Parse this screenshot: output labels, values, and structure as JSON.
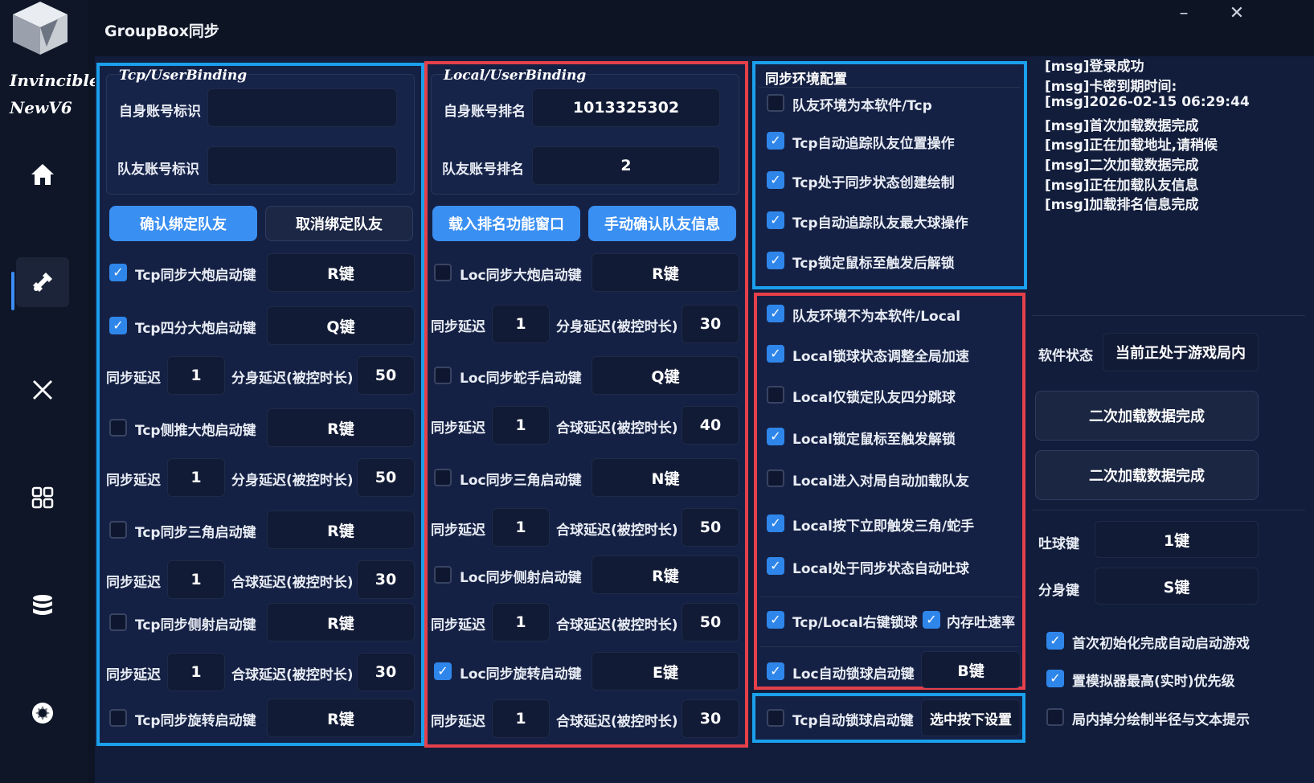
{
  "app": {
    "title": "GroupBox同步",
    "brand_line1": "Invincible",
    "brand_line2": "NewV6"
  },
  "tcp": {
    "legend": "Tcp/UserBinding",
    "self_label": "自身账号标识",
    "self_value": "",
    "mate_label": "队友账号标识",
    "mate_value": "",
    "confirm_button": "确认绑定队友",
    "cancel_button": "取消绑定队友",
    "rows": [
      {
        "type": "check",
        "checked": true,
        "label": "Tcp同步大炮启动键",
        "key": "R键"
      },
      {
        "type": "check",
        "checked": true,
        "label": "Tcp四分大炮启动键",
        "key": "Q键"
      },
      {
        "type": "delay",
        "label": "同步延迟",
        "value": "1",
        "label2": "分身延迟(被控时长)",
        "value2": "50"
      },
      {
        "type": "check",
        "checked": false,
        "label": "Tcp侧推大炮启动键",
        "key": "R键"
      },
      {
        "type": "delay",
        "label": "同步延迟",
        "value": "1",
        "label2": "分身延迟(被控时长)",
        "value2": "50"
      },
      {
        "type": "check",
        "checked": false,
        "label": "Tcp同步三角启动键",
        "key": "R键"
      },
      {
        "type": "delay",
        "label": "同步延迟",
        "value": "1",
        "label2": "合球延迟(被控时长)",
        "value2": "30"
      },
      {
        "type": "check",
        "checked": false,
        "label": "Tcp同步侧射启动键",
        "key": "R键"
      },
      {
        "type": "delay",
        "label": "同步延迟",
        "value": "1",
        "label2": "合球延迟(被控时长)",
        "value2": "30"
      },
      {
        "type": "check",
        "checked": false,
        "label": "Tcp同步旋转启动键",
        "key": "R键"
      }
    ]
  },
  "local": {
    "legend": "Local/UserBinding",
    "self_label": "自身账号排名",
    "self_value": "1013325302",
    "mate_label": "队友账号排名",
    "mate_value": "2",
    "load_button": "载入排名功能窗口",
    "manual_button": "手动确认队友信息",
    "rows": [
      {
        "type": "check",
        "checked": false,
        "label": "Loc同步大炮启动键",
        "key": "R键"
      },
      {
        "type": "delay",
        "label": "同步延迟",
        "value": "1",
        "label2": "分身延迟(被控时长)",
        "value2": "30"
      },
      {
        "type": "check",
        "checked": false,
        "label": "Loc同步蛇手启动键",
        "key": "Q键"
      },
      {
        "type": "delay",
        "label": "同步延迟",
        "value": "1",
        "label2": "合球延迟(被控时长)",
        "value2": "40"
      },
      {
        "type": "check",
        "checked": false,
        "label": "Loc同步三角启动键",
        "key": "N键"
      },
      {
        "type": "delay",
        "label": "同步延迟",
        "value": "1",
        "label2": "合球延迟(被控时长)",
        "value2": "50"
      },
      {
        "type": "check",
        "checked": false,
        "label": "Loc同步侧射启动键",
        "key": "R键"
      },
      {
        "type": "delay",
        "label": "同步延迟",
        "value": "1",
        "label2": "合球延迟(被控时长)",
        "value2": "50"
      },
      {
        "type": "check",
        "checked": true,
        "label": "Loc同步旋转启动键",
        "key": "E键"
      },
      {
        "type": "delay",
        "label": "同步延迟",
        "value": "1",
        "label2": "合球延迟(被控时长)",
        "value2": "30"
      }
    ]
  },
  "sync_env": {
    "legend": "同步环境配置",
    "items": [
      {
        "checked": false,
        "label": "队友环境为本软件/Tcp"
      },
      {
        "checked": true,
        "label": "Tcp自动追踪队友位置操作"
      },
      {
        "checked": true,
        "label": "Tcp处于同步状态创建绘制"
      },
      {
        "checked": true,
        "label": "Tcp自动追踪队友最大球操作"
      },
      {
        "checked": true,
        "label": "Tcp锁定鼠标至触发后解锁"
      }
    ]
  },
  "local_env": {
    "items": [
      {
        "checked": true,
        "label": "队友环境不为本软件/Local"
      },
      {
        "checked": true,
        "label": "Local锁球状态调整全局加速"
      },
      {
        "checked": false,
        "label": "Local仅锁定队友四分跳球"
      },
      {
        "checked": true,
        "label": "Local锁定鼠标至触发解锁"
      },
      {
        "checked": false,
        "label": "Local进入对局自动加载队友"
      },
      {
        "checked": true,
        "label": "Local按下立即触发三角/蛇手"
      },
      {
        "checked": true,
        "label": "Local处于同步状态自动吐球"
      }
    ],
    "right_key_label": "Tcp/Local右键锁球",
    "right_key_checked": true,
    "mem_label": "内存吐速率",
    "mem_checked": true,
    "auto_lock_label": "Loc自动锁球启动键",
    "auto_lock_checked": true,
    "auto_lock_key": "B键"
  },
  "tcp_auto_lock": {
    "checked": false,
    "label": "Tcp自动锁球启动键",
    "key": "选中按下设置"
  },
  "log": {
    "lines": [
      "[msg]登录成功",
      "[msg]卡密到期时间:",
      "[msg]2026-02-15 06:29:44",
      "[msg]首次加载数据完成",
      "[msg]正在加载地址,请稍候",
      "[msg]二次加载数据完成",
      "[msg]正在加载队友信息",
      "[msg]加载排名信息完成"
    ]
  },
  "status": {
    "label": "软件状态",
    "value": "当前正处于游戏局内",
    "button1": "二次加载数据完成",
    "button2": "二次加载数据完成",
    "spit_label": "吐球键",
    "spit_key": "1键",
    "split_label": "分身键",
    "split_key": "S键",
    "options": [
      {
        "checked": true,
        "label": "首次初始化完成自动启动游戏"
      },
      {
        "checked": true,
        "label": "置模拟器最高(实时)优先级"
      },
      {
        "checked": false,
        "label": "局内掉分绘制半径与文本提示"
      }
    ]
  },
  "colors": {
    "blue_border": "#1aa0ec",
    "red_border": "#e5404a",
    "accent": "#3a8ff2"
  }
}
